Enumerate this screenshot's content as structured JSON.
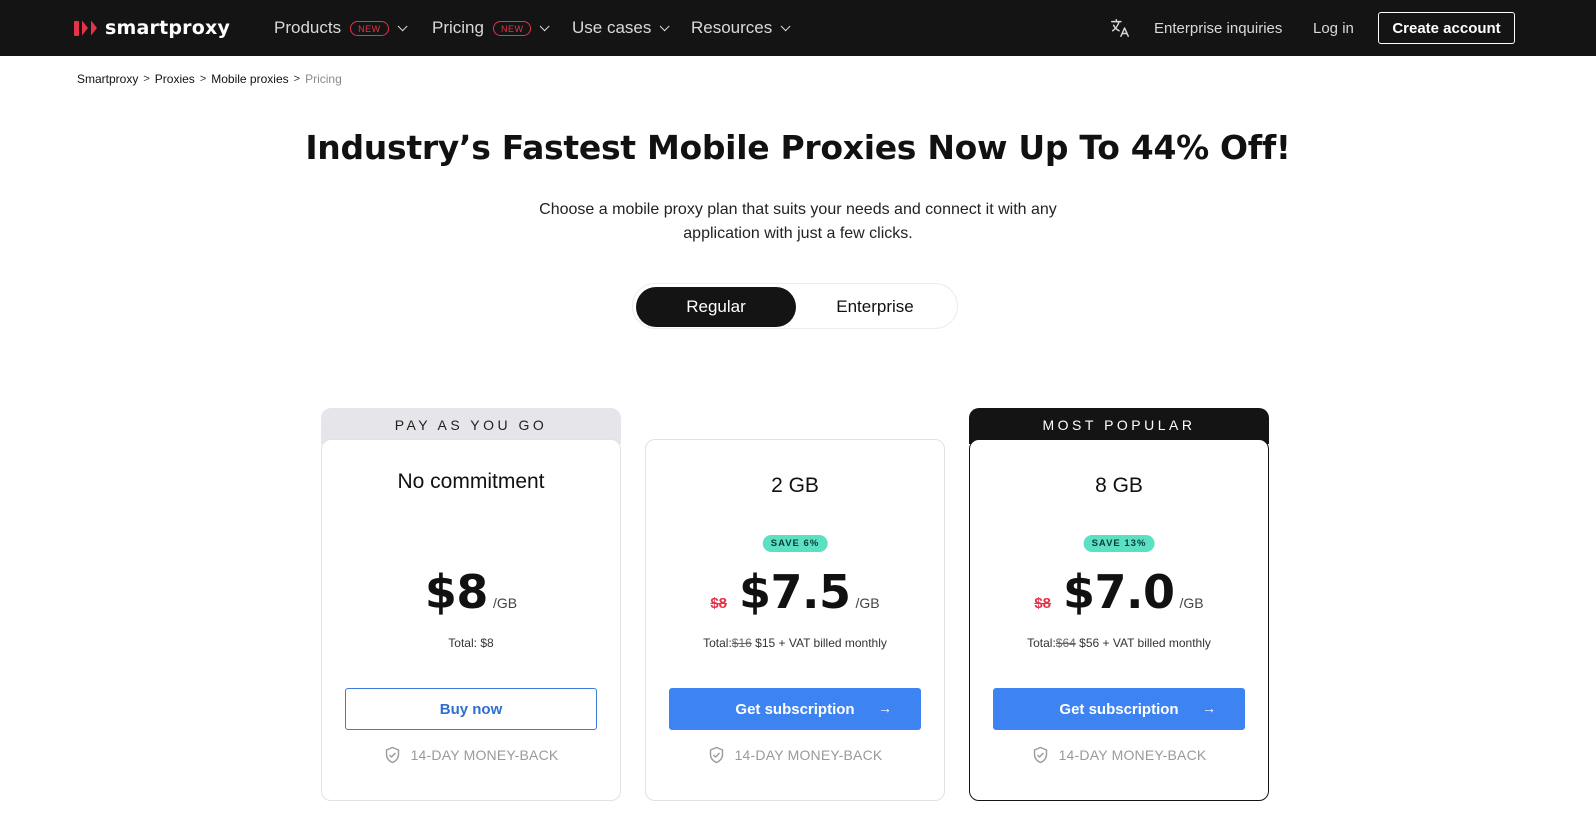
{
  "brand": {
    "name": "smartproxy",
    "accent": "#e3344a"
  },
  "nav": {
    "items": [
      {
        "label": "Products",
        "badge": "NEW"
      },
      {
        "label": "Pricing",
        "badge": "NEW"
      },
      {
        "label": "Use cases"
      },
      {
        "label": "Resources"
      }
    ],
    "right": {
      "language_icon": "translate-icon",
      "enterprise": "Enterprise inquiries",
      "login": "Log in",
      "create": "Create account"
    }
  },
  "breadcrumb": [
    "Smartproxy",
    "Proxies",
    "Mobile proxies",
    "Pricing"
  ],
  "hero": {
    "title": "Industry’s Fastest Mobile Proxies Now Up To 44% Off!",
    "subtitle": "Choose a mobile proxy plan that suits your needs and connect it with any application with just a few clicks."
  },
  "toggle": {
    "options": [
      "Regular",
      "Enterprise"
    ],
    "selected": "Regular"
  },
  "plans": [
    {
      "tab": "PAY AS YOU GO",
      "title": "No commitment",
      "price": "$8",
      "unit": "/GB",
      "total_prefix": "Total:",
      "total": "$8",
      "button": "Buy now",
      "guarantee": "14-DAY MONEY-BACK"
    },
    {
      "title": "2 GB",
      "save": "SAVE 6%",
      "old_price": "$8",
      "price": "$7.5",
      "unit": "/GB",
      "total_prefix": "Total:",
      "total_old": "$16",
      "total": "$15 + VAT billed monthly",
      "button": "Get subscription",
      "guarantee": "14-DAY MONEY-BACK"
    },
    {
      "tab": "MOST POPULAR",
      "title": "8 GB",
      "save": "SAVE 13%",
      "old_price": "$8",
      "price": "$7.0",
      "unit": "/GB",
      "total_prefix": "Total:",
      "total_old": "$64",
      "total": "$56 + VAT billed monthly",
      "button": "Get subscription",
      "guarantee": "14-DAY MONEY-BACK"
    }
  ],
  "colors": {
    "primary_button": "#3d84f2",
    "save_badge": "#5ce0c3",
    "nav_bg": "#141414"
  }
}
